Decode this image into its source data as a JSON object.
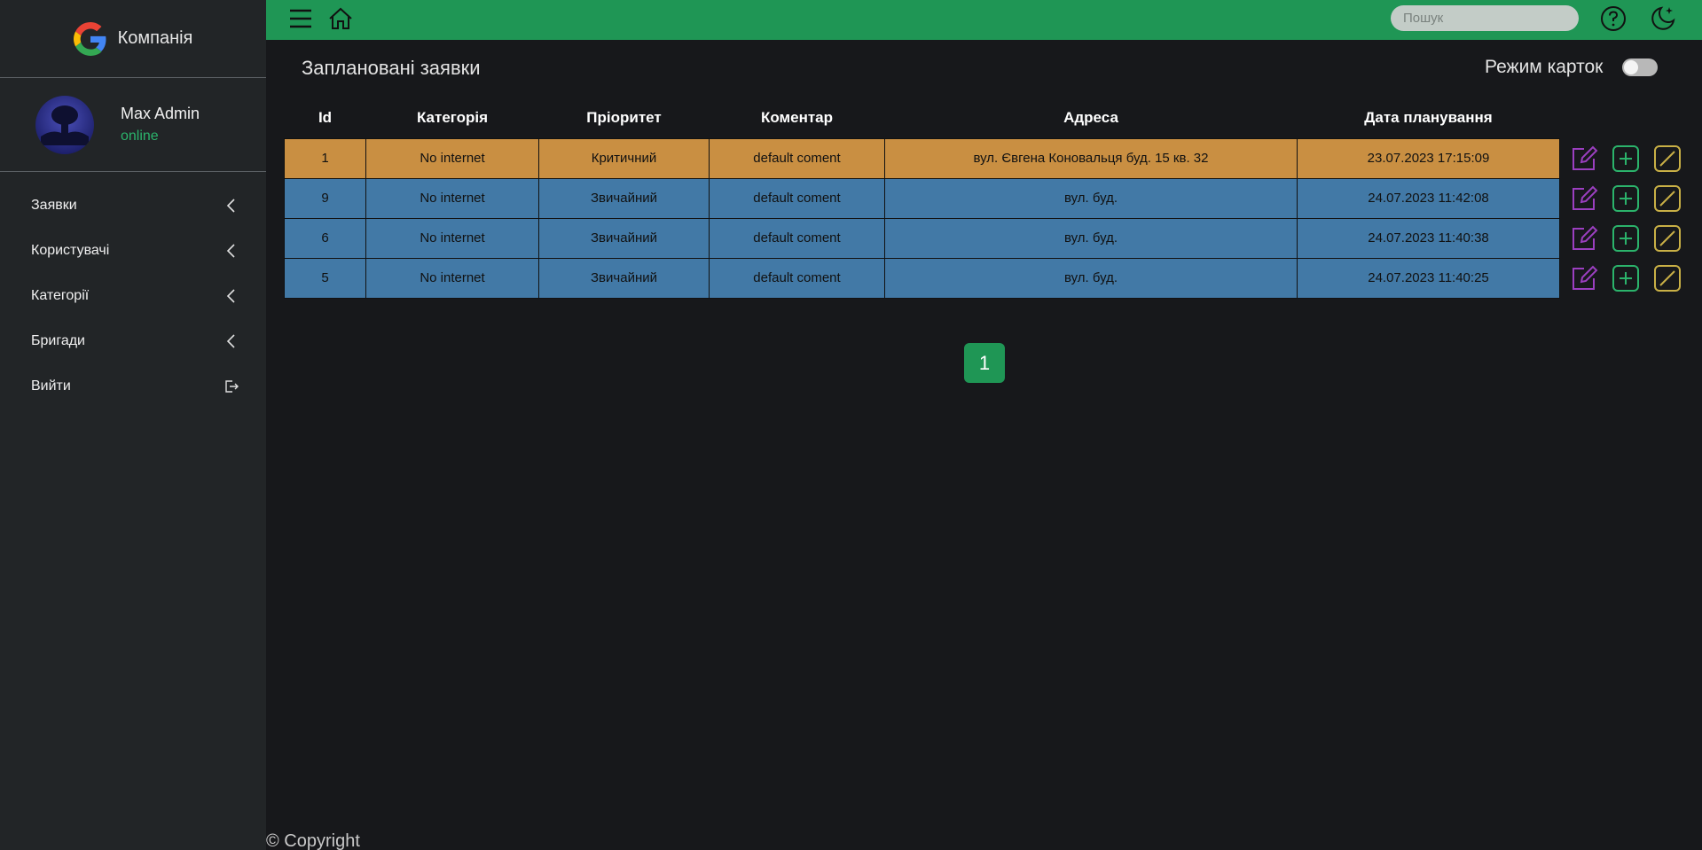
{
  "sidebar": {
    "brand_name": "Компанія",
    "user": {
      "name": "Max Admin",
      "status": "online"
    },
    "items": [
      {
        "label": "Заявки",
        "icon": "chevron-left-icon"
      },
      {
        "label": "Користувачі",
        "icon": "chevron-left-icon"
      },
      {
        "label": "Категорії",
        "icon": "chevron-left-icon"
      },
      {
        "label": "Бригади",
        "icon": "chevron-left-icon"
      },
      {
        "label": "Вийти",
        "icon": "logout-icon"
      }
    ]
  },
  "topbar": {
    "search_placeholder": "Пошук",
    "icons": [
      "menu-icon",
      "home-icon",
      "search-icon",
      "help-icon",
      "theme-moon-icon"
    ]
  },
  "main": {
    "title": "Заплановані заявки",
    "cards_mode_label": "Режим карток",
    "cards_mode_on": false,
    "columns": [
      "Id",
      "Категорія",
      "Пріоритет",
      "Коментар",
      "Адреса",
      "Дата планування"
    ],
    "rows": [
      {
        "id": "1",
        "category": "No internet",
        "priority": "Критичний",
        "comment": "default coment",
        "address": "вул. Євгена Коновальця буд. 15 кв. 32",
        "date": "23.07.2023 17:15:09"
      },
      {
        "id": "9",
        "category": "No internet",
        "priority": "Звичайний",
        "comment": "default coment",
        "address": "вул. буд.",
        "date": "24.07.2023 11:42:08"
      },
      {
        "id": "6",
        "category": "No internet",
        "priority": "Звичайний",
        "comment": "default coment",
        "address": "вул. буд.",
        "date": "24.07.2023 11:40:38"
      },
      {
        "id": "5",
        "category": "No internet",
        "priority": "Звичайний",
        "comment": "default coment",
        "address": "вул. буд.",
        "date": "24.07.2023 11:40:25"
      }
    ],
    "row_actions": [
      "edit-icon",
      "add-icon",
      "cancel-icon"
    ],
    "pagination": {
      "current": "1"
    }
  },
  "footer": {
    "copyright": "© Copyright"
  },
  "colors": {
    "topbar": "#1f9655",
    "sidebar": "#222527",
    "background": "#17181b",
    "critical_row": "#c98f42",
    "normal_row": "#4279a6",
    "edit_icon": "#9b3fc0",
    "add_icon": "#2bb36b",
    "cancel_icon": "#c9b046",
    "status_online": "#2bb36b"
  }
}
